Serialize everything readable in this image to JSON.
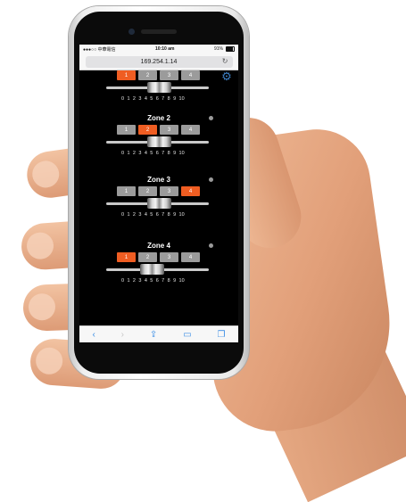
{
  "status_bar": {
    "carrier": "●●●○○ 中華電信",
    "time": "10:10 am",
    "battery": "91%"
  },
  "browser": {
    "url": "169.254.1.14"
  },
  "zones": [
    {
      "title": "",
      "active": 1,
      "slider_value": 5
    },
    {
      "title": "Zone 2",
      "active": 2,
      "slider_value": 5
    },
    {
      "title": "Zone 3",
      "active": 4,
      "slider_value": 5
    },
    {
      "title": "Zone 4",
      "active": 1,
      "slider_value": 4
    }
  ],
  "button_labels": [
    "1",
    "2",
    "3",
    "4"
  ],
  "ticks": [
    "0",
    "1",
    "2",
    "3",
    "4",
    "5",
    "6",
    "7",
    "8",
    "9",
    "10"
  ],
  "icons": {
    "settings": "gear-icon",
    "back": "chevron-left-icon",
    "forward": "chevron-right-icon",
    "share": "share-icon",
    "bookmarks": "book-icon",
    "tabs": "tabs-icon"
  },
  "colors": {
    "active": "#ef5d22",
    "inactive": "#9b9b9b",
    "link": "#3b8ee6"
  }
}
